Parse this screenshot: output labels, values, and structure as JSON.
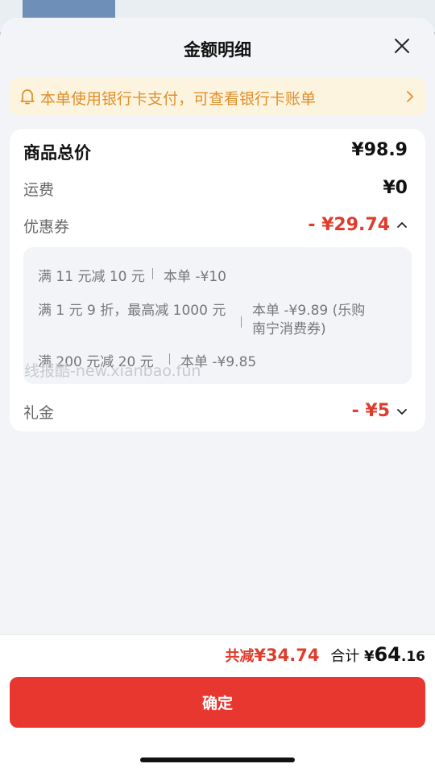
{
  "sheet": {
    "title": "金额明细"
  },
  "notice": {
    "text": "本单使用银行卡支付，可查看银行卡账单"
  },
  "summary": {
    "total_label": "商品总价",
    "total_value": "¥98.9",
    "shipping_label": "运费",
    "shipping_value": "¥0",
    "coupon_label": "优惠券",
    "coupon_value": "- ¥29.74",
    "gift_label": "礼金",
    "gift_value": "- ¥5"
  },
  "coupons": [
    {
      "rule": "满 11 元减 10 元",
      "detail": "本单 -¥10"
    },
    {
      "rule": "满 1 元 9 折，最高减 1000 元",
      "detail_line1": "本单 -¥9.89 (乐购",
      "detail_line2": "南宁消费券)"
    },
    {
      "rule": "满 200 元减 20 元",
      "detail": "本单 -¥9.85"
    }
  ],
  "watermark": "线报酷-new.xianbao.fun",
  "footer": {
    "saved_label": "共减",
    "saved_value": "¥34.74",
    "total_label": "合计",
    "total_currency": "¥",
    "total_int": "64",
    "total_dec": ".16",
    "confirm_label": "确定"
  },
  "colors": {
    "accent": "#e8372f",
    "discount": "#e03c2c",
    "notice_bg": "#fdf4e0",
    "notice_text": "#e0902a"
  }
}
